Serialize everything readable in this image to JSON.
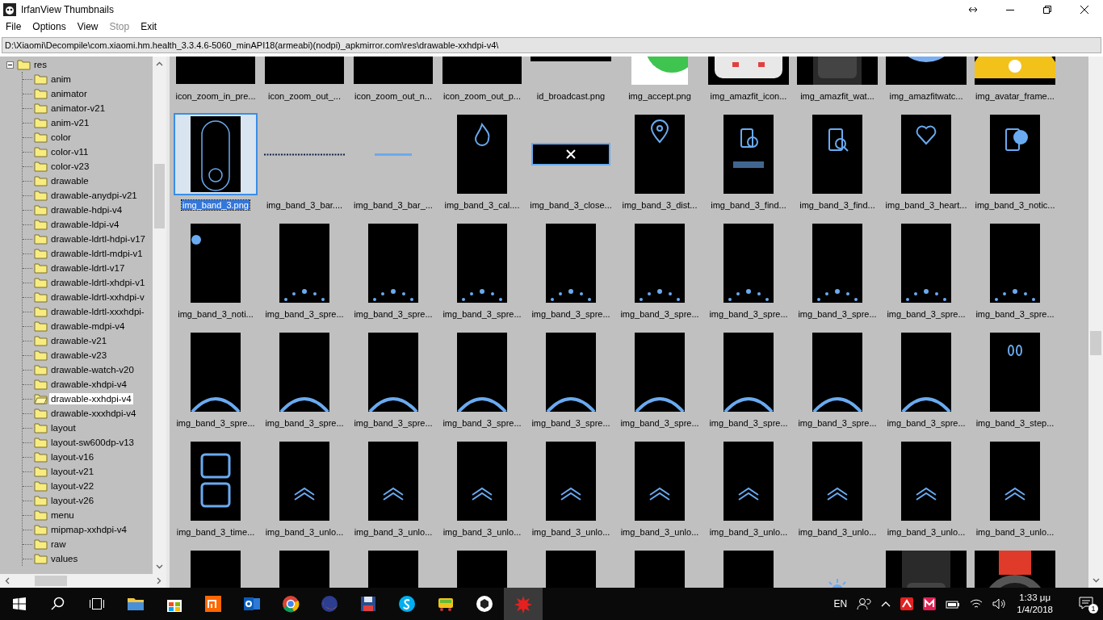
{
  "window": {
    "title": "IrfanView Thumbnails"
  },
  "menu": [
    {
      "label": "File",
      "disabled": false
    },
    {
      "label": "Options",
      "disabled": false
    },
    {
      "label": "View",
      "disabled": false
    },
    {
      "label": "Stop",
      "disabled": true
    },
    {
      "label": "Exit",
      "disabled": false
    }
  ],
  "path": "D:\\Xiaomi\\Decompile\\com.xiaomi.hm.health_3.3.4.6-5060_minAPI18(armeabi)(nodpi)_apkmirror.com\\res\\drawable-xxhdpi-v4\\",
  "tree": {
    "label": "res",
    "expanded": true,
    "selected": false,
    "children": [
      {
        "label": "anim",
        "selected": false
      },
      {
        "label": "animator",
        "selected": false
      },
      {
        "label": "animator-v21",
        "selected": false
      },
      {
        "label": "anim-v21",
        "selected": false
      },
      {
        "label": "color",
        "selected": false
      },
      {
        "label": "color-v11",
        "selected": false
      },
      {
        "label": "color-v23",
        "selected": false
      },
      {
        "label": "drawable",
        "selected": false
      },
      {
        "label": "drawable-anydpi-v21",
        "selected": false
      },
      {
        "label": "drawable-hdpi-v4",
        "selected": false
      },
      {
        "label": "drawable-ldpi-v4",
        "selected": false
      },
      {
        "label": "drawable-ldrtl-hdpi-v17",
        "selected": false
      },
      {
        "label": "drawable-ldrtl-mdpi-v1",
        "selected": false
      },
      {
        "label": "drawable-ldrtl-v17",
        "selected": false
      },
      {
        "label": "drawable-ldrtl-xhdpi-v1",
        "selected": false
      },
      {
        "label": "drawable-ldrtl-xxhdpi-v",
        "selected": false
      },
      {
        "label": "drawable-ldrtl-xxxhdpi-",
        "selected": false
      },
      {
        "label": "drawable-mdpi-v4",
        "selected": false
      },
      {
        "label": "drawable-v21",
        "selected": false
      },
      {
        "label": "drawable-v23",
        "selected": false
      },
      {
        "label": "drawable-watch-v20",
        "selected": false
      },
      {
        "label": "drawable-xhdpi-v4",
        "selected": false
      },
      {
        "label": "drawable-xxhdpi-v4",
        "selected": true
      },
      {
        "label": "drawable-xxxhdpi-v4",
        "selected": false
      },
      {
        "label": "layout",
        "selected": false
      },
      {
        "label": "layout-sw600dp-v13",
        "selected": false
      },
      {
        "label": "layout-v16",
        "selected": false
      },
      {
        "label": "layout-v21",
        "selected": false
      },
      {
        "label": "layout-v22",
        "selected": false
      },
      {
        "label": "layout-v26",
        "selected": false
      },
      {
        "label": "menu",
        "selected": false
      },
      {
        "label": "mipmap-xxhdpi-v4",
        "selected": false
      },
      {
        "label": "raw",
        "selected": false
      },
      {
        "label": "values",
        "selected": false
      }
    ]
  },
  "thumbnails": [
    {
      "kind": "dark",
      "label": "icon_zoom_in_pre...",
      "selected": false
    },
    {
      "kind": "dark",
      "label": "icon_zoom_out_...",
      "selected": false
    },
    {
      "kind": "dark",
      "label": "icon_zoom_out_n...",
      "selected": false
    },
    {
      "kind": "dark",
      "label": "icon_zoom_out_p...",
      "selected": false
    },
    {
      "kind": "broadcast",
      "label": "id_broadcast.png",
      "selected": false
    },
    {
      "kind": "chat",
      "label": "img_accept.png",
      "selected": false
    },
    {
      "kind": "device",
      "label": "img_amazfit_icon...",
      "selected": false
    },
    {
      "kind": "watch",
      "label": "img_amazfit_wat...",
      "selected": false
    },
    {
      "kind": "avatar",
      "label": "img_amazfitwatc...",
      "selected": false
    },
    {
      "kind": "crown",
      "label": "img_avatar_frame...",
      "selected": false
    },
    {
      "kind": "band",
      "label": "img_band_3.png",
      "selected": true
    },
    {
      "kind": "dotted",
      "label": "img_band_3_bar....",
      "selected": false
    },
    {
      "kind": "line",
      "label": "img_band_3_bar_...",
      "selected": false
    },
    {
      "kind": "flame",
      "label": "img_band_3_cal....",
      "selected": false
    },
    {
      "kind": "close",
      "label": "img_band_3_close...",
      "selected": false
    },
    {
      "kind": "pin",
      "label": "img_band_3_dist...",
      "selected": false
    },
    {
      "kind": "findphone",
      "label": "img_band_3_find...",
      "selected": false
    },
    {
      "kind": "phonesearch",
      "label": "img_band_3_find...",
      "selected": false
    },
    {
      "kind": "heart",
      "label": "img_band_3_heart...",
      "selected": false
    },
    {
      "kind": "notice",
      "label": "img_band_3_notic...",
      "selected": false
    },
    {
      "kind": "bubble",
      "label": "img_band_3_noti...",
      "selected": false
    },
    {
      "kind": "dots",
      "label": "img_band_3_spre...",
      "selected": false
    },
    {
      "kind": "dots",
      "label": "img_band_3_spre...",
      "selected": false
    },
    {
      "kind": "dots",
      "label": "img_band_3_spre...",
      "selected": false
    },
    {
      "kind": "dots",
      "label": "img_band_3_spre...",
      "selected": false
    },
    {
      "kind": "dots",
      "label": "img_band_3_spre...",
      "selected": false
    },
    {
      "kind": "dots",
      "label": "img_band_3_spre...",
      "selected": false
    },
    {
      "kind": "dots",
      "label": "img_band_3_spre...",
      "selected": false
    },
    {
      "kind": "dots",
      "label": "img_band_3_spre...",
      "selected": false
    },
    {
      "kind": "dots",
      "label": "img_band_3_spre...",
      "selected": false
    },
    {
      "kind": "arc",
      "label": "img_band_3_spre...",
      "selected": false
    },
    {
      "kind": "arc",
      "label": "img_band_3_spre...",
      "selected": false
    },
    {
      "kind": "arc",
      "label": "img_band_3_spre...",
      "selected": false
    },
    {
      "kind": "arc",
      "label": "img_band_3_spre...",
      "selected": false
    },
    {
      "kind": "arc",
      "label": "img_band_3_spre...",
      "selected": false
    },
    {
      "kind": "arc",
      "label": "img_band_3_spre...",
      "selected": false
    },
    {
      "kind": "arc",
      "label": "img_band_3_spre...",
      "selected": false
    },
    {
      "kind": "arc",
      "label": "img_band_3_spre...",
      "selected": false
    },
    {
      "kind": "arc",
      "label": "img_band_3_spre...",
      "selected": false
    },
    {
      "kind": "steps",
      "label": "img_band_3_step...",
      "selected": false
    },
    {
      "kind": "time",
      "label": "img_band_3_time...",
      "selected": false
    },
    {
      "kind": "chevron",
      "label": "img_band_3_unlo...",
      "selected": false
    },
    {
      "kind": "chevron",
      "label": "img_band_3_unlo...",
      "selected": false
    },
    {
      "kind": "chevron",
      "label": "img_band_3_unlo...",
      "selected": false
    },
    {
      "kind": "chevron",
      "label": "img_band_3_unlo...",
      "selected": false
    },
    {
      "kind": "chevron",
      "label": "img_band_3_unlo...",
      "selected": false
    },
    {
      "kind": "chevron",
      "label": "img_band_3_unlo...",
      "selected": false
    },
    {
      "kind": "chevron",
      "label": "img_band_3_unlo...",
      "selected": false
    },
    {
      "kind": "chevron",
      "label": "img_band_3_unlo...",
      "selected": false
    },
    {
      "kind": "chevron",
      "label": "img_band_3_unlo...",
      "selected": false
    },
    {
      "kind": "chevron",
      "selected": false
    },
    {
      "kind": "chevron",
      "selected": false
    },
    {
      "kind": "chevron",
      "selected": false
    },
    {
      "kind": "chevron",
      "selected": false
    },
    {
      "kind": "chevron",
      "selected": false
    },
    {
      "kind": "chevron",
      "selected": false
    },
    {
      "kind": "chevron",
      "selected": false
    },
    {
      "kind": "sun",
      "selected": false
    },
    {
      "kind": "watch",
      "selected": false
    },
    {
      "kind": "redwatch",
      "selected": false
    }
  ],
  "taskbar": {
    "apps": [
      {
        "kind": "folder",
        "selected": false
      },
      {
        "kind": "bag",
        "selected": false
      },
      {
        "kind": "tile",
        "selected": false
      },
      {
        "kind": "mail",
        "selected": false
      },
      {
        "kind": "chrome",
        "selected": false
      },
      {
        "kind": "fox",
        "selected": false
      },
      {
        "kind": "floppy",
        "selected": false
      },
      {
        "kind": "cloud",
        "selected": false
      },
      {
        "kind": "bus",
        "selected": false
      },
      {
        "kind": "cube",
        "selected": false
      },
      {
        "kind": "splash",
        "selected": true
      }
    ],
    "language": "EN",
    "time": "1:33 μμ",
    "date": "1/4/2018",
    "notifications": "1"
  }
}
